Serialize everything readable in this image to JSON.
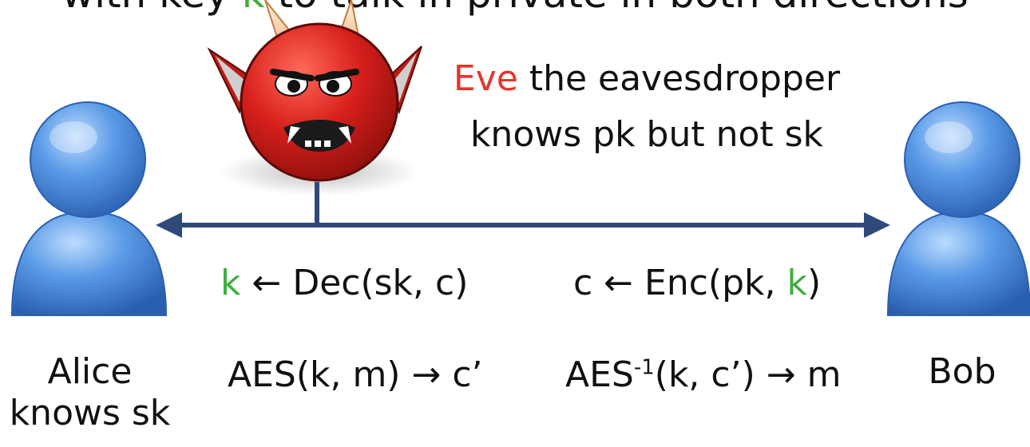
{
  "title": {
    "pre": "with key ",
    "key": "k",
    "post": " to talk in private in both directions"
  },
  "eve": {
    "name": "Eve",
    "line1_rest": " the eavesdropper",
    "line2": "knows pk but not sk"
  },
  "alice": {
    "name": "Alice",
    "knows": "knows sk"
  },
  "bob": {
    "name": "Bob"
  },
  "protocol": {
    "dec": {
      "k": "k",
      "rest": " ← Dec(sk, c)"
    },
    "enc": {
      "pre": "c ← Enc(pk, ",
      "k": "k",
      "post": ")"
    },
    "aes": "AES(k, m) → c’",
    "aes_inv": {
      "pre": "AES",
      "sup": "-1",
      "post": "(k, c’) → m"
    }
  },
  "colors": {
    "eve_name": "#e5352b",
    "key": "#3fae3f",
    "arrow": "#2f4a7a",
    "person_fill": "#5a9ae6",
    "devil_fill": "#d8201c"
  },
  "icons": [
    "alice-person-icon",
    "bob-person-icon",
    "eve-devil-icon"
  ]
}
